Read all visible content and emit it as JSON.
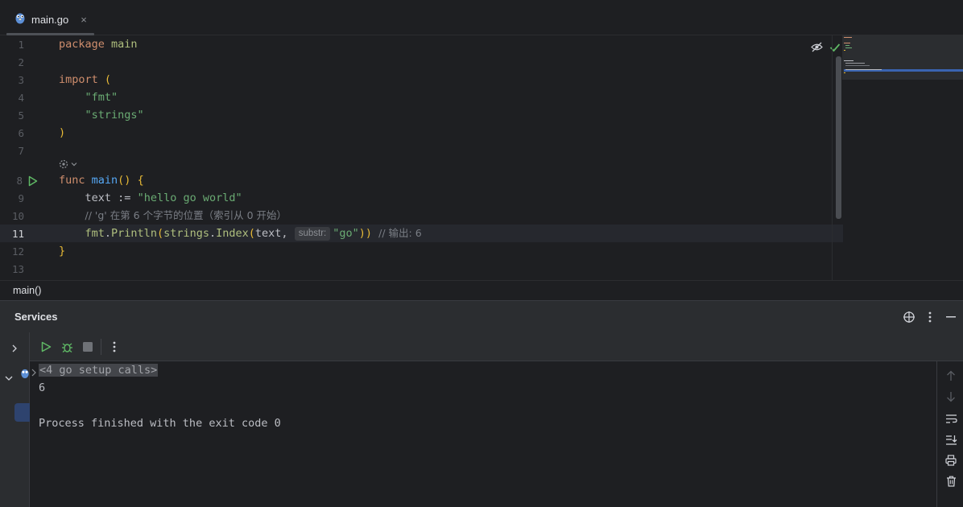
{
  "tab": {
    "filename": "main.go",
    "close": "×",
    "icon": "gopher-icon"
  },
  "editor": {
    "line_numbers": [
      "1",
      "2",
      "3",
      "4",
      "5",
      "6",
      "7",
      "8",
      "9",
      "10",
      "11",
      "12",
      "13"
    ],
    "current_line": "11",
    "lines": {
      "l1_kw": "package",
      "l1_name": "main",
      "l3_kw": "import",
      "l3_paren": "(",
      "l4_str": "\"fmt\"",
      "l5_str": "\"strings\"",
      "l6_paren": ")",
      "l8_kw": "func",
      "l8_fn": "main",
      "l8_paren": "()",
      "l8_brace": "{",
      "l9_var": "text",
      "l9_op": ":=",
      "l9_str": "\"hello go world\"",
      "l10_cmt": "// 'g' 在第 6 个字节的位置（索引从 0 开始）",
      "l11_pkg1": "fmt",
      "l11_fn1": "Println",
      "l11_pkg2": "strings",
      "l11_fn2": "Index",
      "l11_arg": "text,",
      "l11_hint": "substr:",
      "l11_str": "\"go\"",
      "l11_cmt": "// 输出: 6",
      "l12_brace": "}"
    }
  },
  "breadcrumb": "main()",
  "services": {
    "title": "Services",
    "console": {
      "setup_calls": "<4 go setup calls>",
      "output": "6",
      "finished": "Process finished with the exit code 0"
    }
  }
}
